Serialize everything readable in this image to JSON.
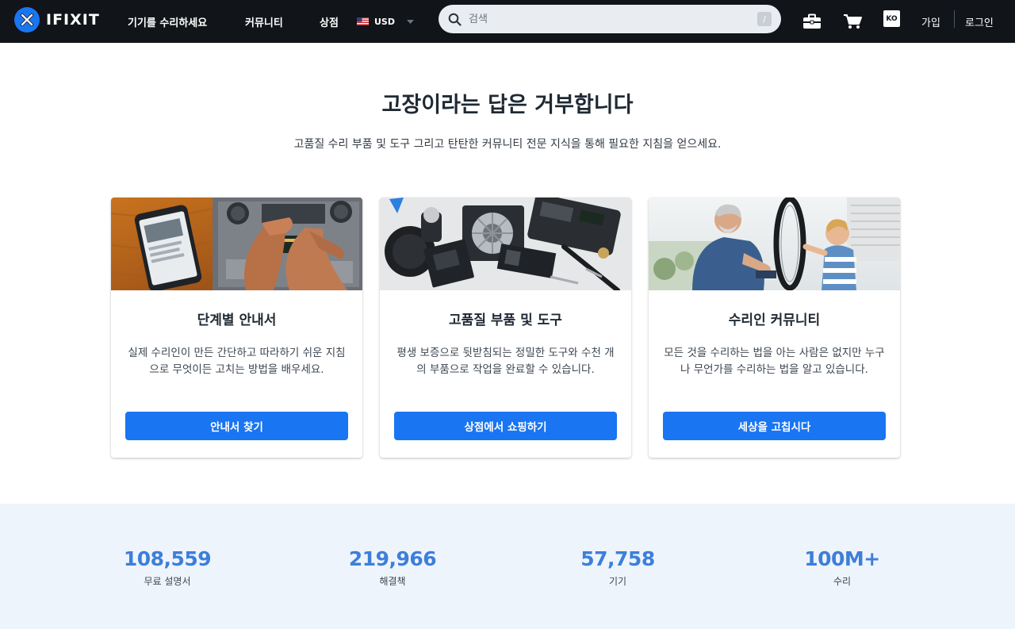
{
  "header": {
    "logo_text": "IFIXIT",
    "nav": {
      "fix": "기기를 수리하세요",
      "community": "커뮤니티",
      "store": "상점"
    },
    "currency": "USD",
    "search": {
      "placeholder": "검색",
      "shortcut": "/"
    },
    "language": "KO",
    "signup": "가입",
    "login": "로그인",
    "icons": [
      "ifixit-logo-icon",
      "us-flag-icon",
      "chevron-down-icon",
      "search-icon",
      "toolbox-icon",
      "cart-icon"
    ]
  },
  "hero": {
    "title": "고장이라는 답은 거부합니다",
    "subtitle": "고품질 수리 부품 및 도구 그리고 탄탄한 커뮤니티 전문 지식을 통해 필요한 지침을 얻으세요."
  },
  "cards": [
    {
      "title": "단계별 안내서",
      "description": "실제 수리인이 만든 간단하고 따라하기 쉬운 지침으로 무엇이든 고치는 방법을 배우세요.",
      "button": "안내서 찾기"
    },
    {
      "title": "고품질 부품 및 도구",
      "description": "평생 보증으로 뒷받침되는 정밀한 도구와 수천 개의 부품으로 작업을 완료할 수 있습니다.",
      "button": "상점에서 쇼핑하기"
    },
    {
      "title": "수리인 커뮤니티",
      "description": "모든 것을 수리하는 법을 아는 사람은 없지만 누구나 무언가를 수리하는 법을 알고 있습니다.",
      "button": "세상을 고칩시다"
    }
  ],
  "stats": [
    {
      "value": "108,559",
      "label": "무료 설명서"
    },
    {
      "value": "219,966",
      "label": "해결책"
    },
    {
      "value": "57,758",
      "label": "기기"
    },
    {
      "value": "100M+",
      "label": "수리"
    }
  ],
  "colors": {
    "header_bg": "#111418",
    "accent": "#1975f1",
    "stat_number": "#3d7fd9",
    "stats_bg": "#eef4fc"
  }
}
